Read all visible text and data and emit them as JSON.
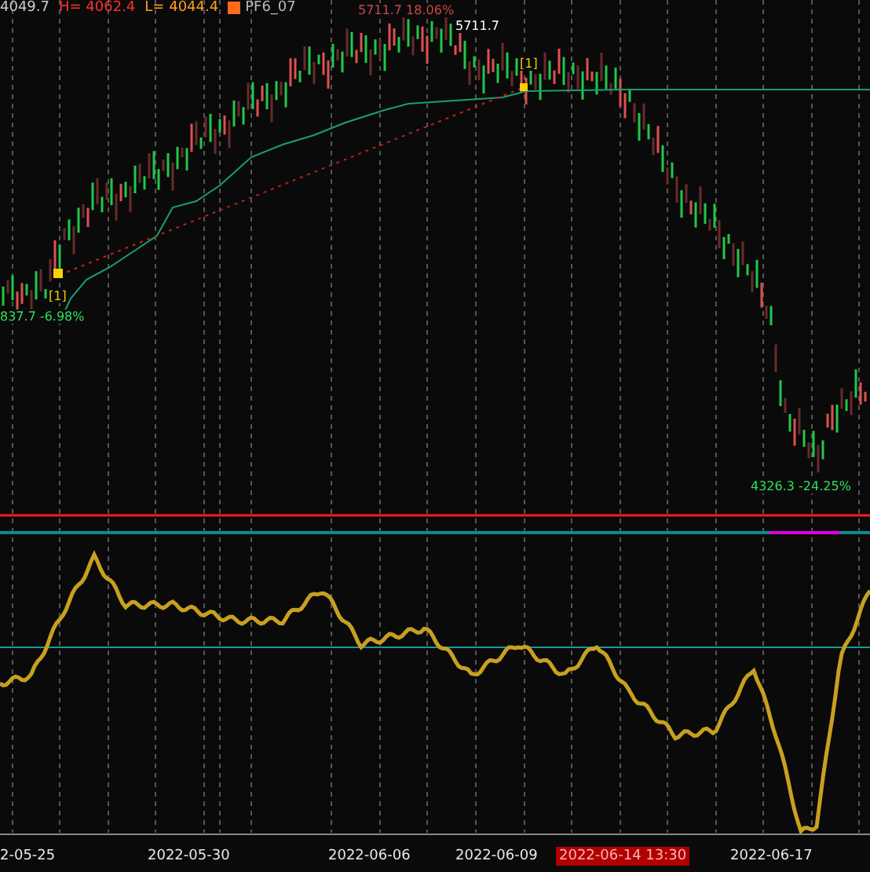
{
  "legend": [
    {
      "text": "4049.7",
      "kind": "value"
    },
    {
      "text": "H= 4062.4",
      "kind": "high"
    },
    {
      "text": "L= 4044.4",
      "kind": "low"
    },
    {
      "text": "PF6_07",
      "kind": "series"
    }
  ],
  "annotations": [
    {
      "text": "5711.7 18.06%",
      "kind": "peak"
    },
    {
      "text": "5711.7",
      "kind": "price"
    },
    {
      "text": "[1]",
      "kind": "signal"
    },
    {
      "text": "[1]",
      "kind": "signal"
    },
    {
      "text": "837.7 -6.98%",
      "kind": "start"
    },
    {
      "text": "4326.3 -24.25%",
      "kind": "low"
    }
  ],
  "time_axis": [
    {
      "label": "2-05-25",
      "selected": false
    },
    {
      "label": "2022-05-30",
      "selected": false
    },
    {
      "label": "2022-06-06",
      "selected": false
    },
    {
      "label": "2022-06-09",
      "selected": false
    },
    {
      "label": "2022-06-14 13:30",
      "selected": true
    },
    {
      "label": "2022-06-17",
      "selected": false
    }
  ]
}
